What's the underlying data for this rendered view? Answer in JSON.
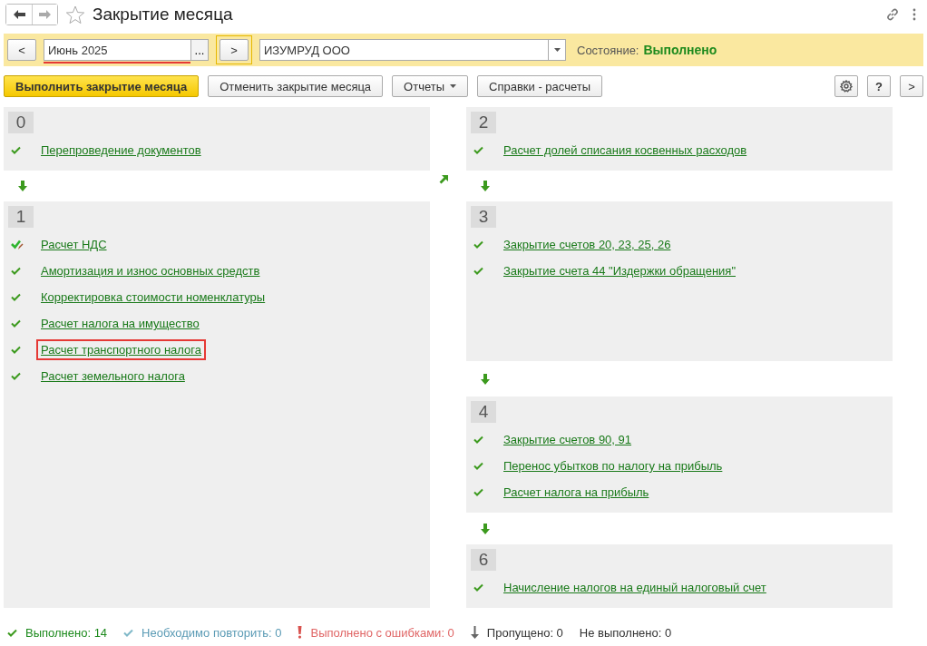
{
  "window": {
    "title": "Закрытие месяца"
  },
  "toolbar": {
    "prev": "<",
    "period": {
      "value": "Июнь 2025",
      "marked": true
    },
    "period_button": "...",
    "next": {
      "label": ">",
      "focused": true
    },
    "organization": "ИЗУМРУД ООО",
    "state_label": "Состояние:",
    "state_value": "Выполнено"
  },
  "actions": [
    {
      "label": "Выполнить закрытие месяца",
      "kind": "primary"
    },
    {
      "label": "Отменить закрытие месяца",
      "kind": "plain"
    },
    {
      "label": "Отчеты",
      "kind": "menu"
    },
    {
      "label": "Справки - расчеты",
      "kind": "plain"
    }
  ],
  "help_button": "?",
  "more_button": ">",
  "columns": [
    [
      {
        "number": "0",
        "steps": [
          {
            "label": "Перепроведение документов",
            "kind": "done",
            "highlighted": false
          }
        ]
      },
      {
        "number": "1",
        "steps": [
          {
            "label": "Расчет НДС",
            "kind": "edited",
            "highlighted": false
          },
          {
            "label": "Амортизация и износ основных средств",
            "kind": "done",
            "highlighted": false
          },
          {
            "label": "Корректировка стоимости номенклатуры",
            "kind": "done",
            "highlighted": false
          },
          {
            "label": "Расчет налога на имущество",
            "kind": "done",
            "highlighted": false
          },
          {
            "label": "Расчет транспортного налога",
            "kind": "done",
            "highlighted": true
          },
          {
            "label": "Расчет земельного налога",
            "kind": "done",
            "highlighted": false
          }
        ]
      }
    ],
    [
      {
        "number": "2",
        "steps": [
          {
            "label": "Расчет долей списания косвенных расходов",
            "kind": "done",
            "highlighted": false
          }
        ]
      },
      {
        "number": "3",
        "steps": [
          {
            "label": "Закрытие счетов 20, 23, 25, 26",
            "kind": "done",
            "highlighted": false
          },
          {
            "label": "Закрытие счета 44 \"Издержки обращения\"",
            "kind": "done",
            "highlighted": false
          }
        ]
      },
      {
        "number": "4",
        "steps": [
          {
            "label": "Закрытие счетов 90, 91",
            "kind": "done",
            "highlighted": false
          },
          {
            "label": "Перенос убытков по налогу на прибыль",
            "kind": "done",
            "highlighted": false
          },
          {
            "label": "Расчет налога на прибыль",
            "kind": "done",
            "highlighted": false
          }
        ]
      },
      {
        "number": "6",
        "steps": [
          {
            "label": "Начисление налогов на единый налоговый счет",
            "kind": "done",
            "highlighted": false
          }
        ]
      }
    ]
  ],
  "legend": [
    {
      "label": "Выполнено:",
      "count": "14",
      "kind": "done"
    },
    {
      "label": "Необходимо повторить:",
      "count": "0",
      "kind": "repeat"
    },
    {
      "label": "Выполнено с ошибками:",
      "count": "0",
      "kind": "error"
    },
    {
      "label": "Пропущено:",
      "count": "0",
      "kind": "skipped"
    },
    {
      "label": "Не выполнено:",
      "count": "0",
      "kind": "none"
    }
  ]
}
